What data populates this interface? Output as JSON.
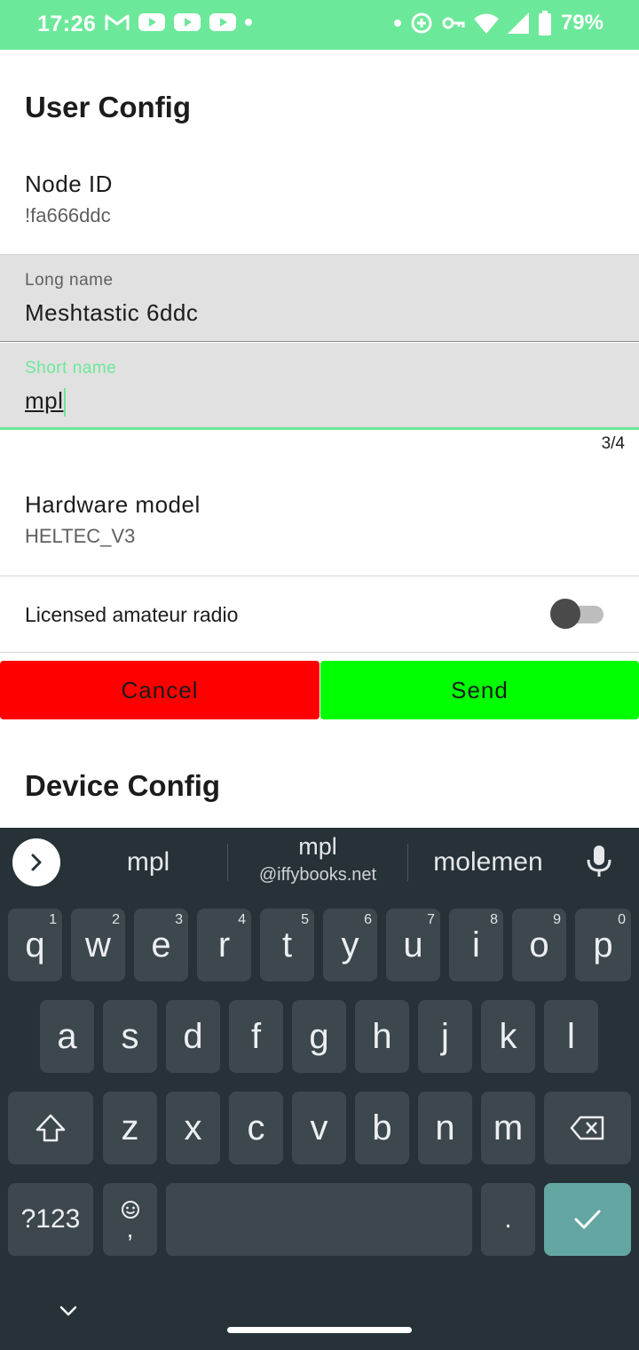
{
  "status_bar": {
    "time": "17:26",
    "battery_percent": "79%",
    "background": "#6ce89a",
    "left_icons": [
      "gmail-icon",
      "youtube-icon",
      "youtube-icon",
      "youtube-icon",
      "dot-icon"
    ],
    "right_icons": [
      "dot-icon",
      "data-saver-icon",
      "vpn-key-icon",
      "wifi-icon",
      "signal-icon",
      "battery-icon"
    ]
  },
  "user_config": {
    "title": "User Config",
    "node_id_label": "Node ID",
    "node_id_value": "!fa666ddc",
    "long_name": {
      "label": "Long name",
      "value": "Meshtastic 6ddc"
    },
    "short_name": {
      "label": "Short name",
      "value": "mpl",
      "counter": "3/4"
    },
    "hardware_model_label": "Hardware model",
    "hardware_model_value": "HELTEC_V3",
    "licensed_label": "Licensed amateur radio",
    "licensed_enabled": false
  },
  "actions": {
    "cancel_label": "Cancel",
    "send_label": "Send",
    "cancel_color": "#ff0000",
    "send_color": "#00ff00"
  },
  "device_config": {
    "title": "Device Config"
  },
  "keyboard": {
    "suggestions": [
      "mpl",
      "mpl",
      "molemen"
    ],
    "suggestion_sub": "@iffybooks.net",
    "row1": [
      {
        "k": "q",
        "h": "1"
      },
      {
        "k": "w",
        "h": "2"
      },
      {
        "k": "e",
        "h": "3"
      },
      {
        "k": "r",
        "h": "4"
      },
      {
        "k": "t",
        "h": "5"
      },
      {
        "k": "y",
        "h": "6"
      },
      {
        "k": "u",
        "h": "7"
      },
      {
        "k": "i",
        "h": "8"
      },
      {
        "k": "o",
        "h": "9"
      },
      {
        "k": "p",
        "h": "0"
      }
    ],
    "row2": [
      "a",
      "s",
      "d",
      "f",
      "g",
      "h",
      "j",
      "k",
      "l"
    ],
    "row3": [
      "z",
      "x",
      "c",
      "v",
      "b",
      "n",
      "m"
    ],
    "symbols_label": "?123",
    "comma_label": ",",
    "period_label": ".",
    "accent": "#64a6a2"
  }
}
